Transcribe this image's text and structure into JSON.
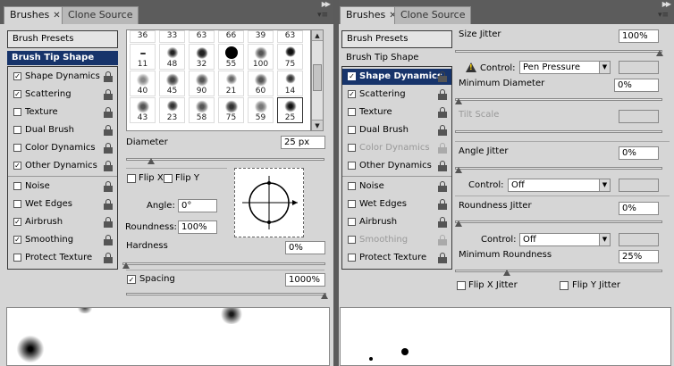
{
  "left": {
    "tabs": [
      {
        "label": "Brushes",
        "close": "✕"
      },
      {
        "label": "Clone Source"
      }
    ],
    "brush_presets_label": "Brush Presets",
    "brush_tip_shape_label": "Brush Tip Shape",
    "options": [
      {
        "label": "Shape Dynamics",
        "checked": "✓"
      },
      {
        "label": "Scattering",
        "checked": "✓"
      },
      {
        "label": "Texture",
        "checked": ""
      },
      {
        "label": "Dual Brush",
        "checked": ""
      },
      {
        "label": "Color Dynamics",
        "checked": ""
      },
      {
        "label": "Other Dynamics",
        "checked": "✓"
      },
      {
        "label": "Noise",
        "checked": ""
      },
      {
        "label": "Wet Edges",
        "checked": ""
      },
      {
        "label": "Airbrush",
        "checked": "✓"
      },
      {
        "label": "Smoothing",
        "checked": "✓"
      },
      {
        "label": "Protect Texture",
        "checked": ""
      }
    ],
    "brush_sizes_top": [
      "36",
      "33",
      "63",
      "66",
      "39",
      "63"
    ],
    "brush_sizes_row1": [
      "11",
      "48",
      "32",
      "55",
      "100",
      "75"
    ],
    "brush_sizes_row2": [
      "40",
      "45",
      "90",
      "21",
      "60",
      "14"
    ],
    "brush_sizes_row3": [
      "43",
      "23",
      "58",
      "75",
      "59",
      "25"
    ],
    "diameter_label": "Diameter",
    "diameter_value": "25 px",
    "flip_x_label": "Flip X",
    "flip_y_label": "Flip Y",
    "angle_label": "Angle:",
    "angle_value": "0°",
    "roundness_label": "Roundness:",
    "roundness_value": "100%",
    "hardness_label": "Hardness",
    "hardness_value": "0%",
    "spacing_label": "Spacing",
    "spacing_checked": "✓",
    "spacing_value": "1000%"
  },
  "right": {
    "tabs": [
      {
        "label": "Brushes",
        "close": "✕"
      },
      {
        "label": "Clone Source"
      }
    ],
    "brush_presets_label": "Brush Presets",
    "brush_tip_shape_label": "Brush Tip Shape",
    "options": [
      {
        "label": "Shape Dynamics",
        "checked": "✓"
      },
      {
        "label": "Scattering",
        "checked": "✓"
      },
      {
        "label": "Texture",
        "checked": ""
      },
      {
        "label": "Dual Brush",
        "checked": ""
      },
      {
        "label": "Color Dynamics",
        "checked": ""
      },
      {
        "label": "Other Dynamics",
        "checked": ""
      },
      {
        "label": "Noise",
        "checked": ""
      },
      {
        "label": "Wet Edges",
        "checked": ""
      },
      {
        "label": "Airbrush",
        "checked": ""
      },
      {
        "label": "Smoothing",
        "checked": ""
      },
      {
        "label": "Protect Texture",
        "checked": ""
      }
    ],
    "size_jitter_label": "Size Jitter",
    "size_jitter_value": "100%",
    "control_label": "Control:",
    "control_value_1": "Pen Pressure",
    "min_diameter_label": "Minimum Diameter",
    "min_diameter_value": "0%",
    "tilt_scale_label": "Tilt Scale",
    "angle_jitter_label": "Angle Jitter",
    "angle_jitter_value": "0%",
    "control_value_2": "Off",
    "roundness_jitter_label": "Roundness Jitter",
    "roundness_jitter_value": "0%",
    "control_value_3": "Off",
    "min_roundness_label": "Minimum Roundness",
    "min_roundness_value": "25%",
    "flip_x_jitter_label": "Flip X Jitter",
    "flip_y_jitter_label": "Flip Y Jitter"
  },
  "colors": {
    "selection": "#17346b",
    "panel": "#d6d6d6",
    "chrome": "#5c5c5c"
  }
}
